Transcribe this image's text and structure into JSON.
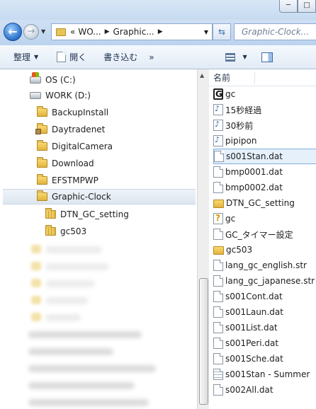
{
  "window": {
    "controls": {
      "minimize": "─",
      "maximize": "□"
    }
  },
  "address": {
    "back": "←",
    "forward": "→",
    "prefix": "«",
    "crumbs": [
      "WO...",
      "Graphic..."
    ],
    "search_placeholder": "Graphic-Clock..."
  },
  "toolbar": {
    "organize": "整理",
    "open": "開く",
    "write": "書き込む",
    "more": "»"
  },
  "nav": {
    "drives": [
      {
        "label": "OS (C:)",
        "icon": "os-drive-icon"
      },
      {
        "label": "WORK (D:)",
        "icon": "drive-icon"
      }
    ],
    "folders": [
      {
        "label": "BackupInstall",
        "icon": "folder-icon"
      },
      {
        "label": "Daytradenet",
        "icon": "locked-folder-icon"
      },
      {
        "label": "DigitalCamera",
        "icon": "folder-icon"
      },
      {
        "label": "Download",
        "icon": "folder-icon"
      },
      {
        "label": "EFSTMPWP",
        "icon": "folder-icon"
      },
      {
        "label": "Graphic-Clock",
        "icon": "folder-icon",
        "selected": true
      }
    ],
    "subfolders": [
      {
        "label": "DTN_GC_setting",
        "icon": "zip-folder-icon"
      },
      {
        "label": "gc503",
        "icon": "zip-folder-icon"
      }
    ]
  },
  "files": {
    "column_name": "名前",
    "items": [
      {
        "label": "gc",
        "icon": "app-icon"
      },
      {
        "label": "15秒経過",
        "icon": "audio-icon"
      },
      {
        "label": "30秒前",
        "icon": "audio-icon"
      },
      {
        "label": "pipipon",
        "icon": "audio-icon"
      },
      {
        "label": "s001Stan.dat",
        "icon": "file-icon",
        "selected": true
      },
      {
        "label": "bmp0001.dat",
        "icon": "file-icon"
      },
      {
        "label": "bmp0002.dat",
        "icon": "file-icon"
      },
      {
        "label": "DTN_GC_setting",
        "icon": "zip-folder-icon"
      },
      {
        "label": "gc",
        "icon": "setup-icon"
      },
      {
        "label": "GC_タイマー設定",
        "icon": "file-icon"
      },
      {
        "label": "gc503",
        "icon": "zip-folder-icon"
      },
      {
        "label": "lang_gc_english.str",
        "icon": "file-icon"
      },
      {
        "label": "lang_gc_japanese.str",
        "icon": "file-icon"
      },
      {
        "label": "s001Cont.dat",
        "icon": "file-icon"
      },
      {
        "label": "s001Laun.dat",
        "icon": "file-icon"
      },
      {
        "label": "s001List.dat",
        "icon": "file-icon"
      },
      {
        "label": "s001Peri.dat",
        "icon": "file-icon"
      },
      {
        "label": "s001Sche.dat",
        "icon": "file-icon"
      },
      {
        "label": "s001Stan - Summer",
        "icon": "text-file-icon"
      },
      {
        "label": "s002All.dat",
        "icon": "file-icon"
      }
    ]
  }
}
